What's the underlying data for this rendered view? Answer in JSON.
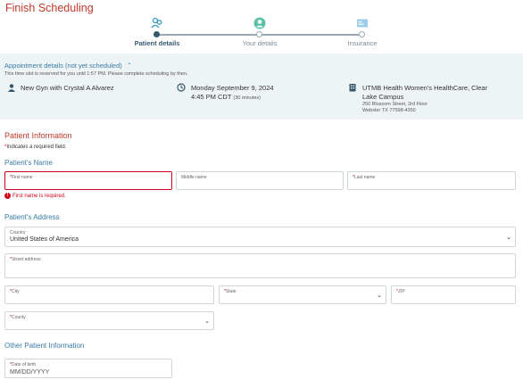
{
  "page": {
    "title": "Finish Scheduling"
  },
  "stepper": {
    "steps": [
      {
        "label": "Patient details",
        "state": "active",
        "icon": "people-icon"
      },
      {
        "label": "Your details",
        "state": "idle",
        "icon": "person-icon"
      },
      {
        "label": "Insurance",
        "state": "idle",
        "icon": "card-icon"
      }
    ]
  },
  "appointment": {
    "header": "Appointment details (not yet scheduled)",
    "reserved_note": "This time slot is reserved for you until 1:57 PM. Please complete scheduling by then.",
    "visit": "New Gyn with Crystal A Alvarez",
    "date": "Monday September 9, 2024",
    "time": "4:45 PM CDT",
    "duration": "(30 minutes)",
    "location_name": "UTMB Health Women's HealthCare, Clear Lake Campus",
    "address_line1": "250 Blossom Street, 3rd Floor",
    "address_line2": "Webster TX 77598-4350"
  },
  "patient_info": {
    "title": "Patient Information",
    "required_note": "Indicates a required field.",
    "name_section": "Patient's Name",
    "first_name_label": "First name",
    "middle_name_label": "Middle name",
    "last_name_label": "Last name",
    "first_name_error": "First name is required.",
    "address_section": "Patient's Address",
    "country_label": "Country",
    "country_value": "United States of America",
    "street_label": "Street address",
    "city_label": "City",
    "state_label": "State",
    "zip_label": "ZIP",
    "county_label": "County",
    "other_section": "Other Patient Information",
    "dob_label": "Date of birth",
    "dob_placeholder": "MM/DD/YYYY"
  },
  "colors": {
    "accent": "#3a7ca5",
    "error": "#d0021b",
    "title": "#c0392b",
    "band": "#eef3f5"
  }
}
